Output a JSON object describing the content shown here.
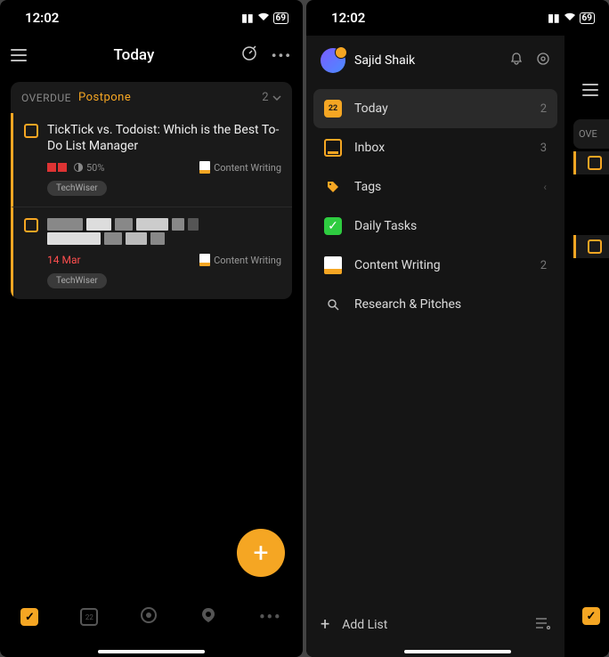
{
  "statusbar": {
    "time": "12:02",
    "battery": "69"
  },
  "left": {
    "title": "Today",
    "section": {
      "label": "OVERDUE",
      "postpone": "Postpone",
      "count": "2"
    },
    "tasks": [
      {
        "title": "TickTick vs. Todoist: Which is the Best To-Do List Manager",
        "progress": "50%",
        "label": "Content Writing",
        "tag": "TechWiser"
      },
      {
        "title_censored": true,
        "date": "14 Mar",
        "label": "Content Writing",
        "tag": "TechWiser"
      }
    ],
    "tabbar": {
      "calendar_day": "22"
    }
  },
  "right": {
    "profile_name": "Sajid Shaik",
    "menu": [
      {
        "icon": "today",
        "label": "Today",
        "count": "2",
        "active": true,
        "day": "22"
      },
      {
        "icon": "inbox",
        "label": "Inbox",
        "count": "3"
      },
      {
        "icon": "tags",
        "label": "Tags",
        "chevron": true
      },
      {
        "icon": "daily",
        "label": "Daily Tasks"
      },
      {
        "icon": "content",
        "label": "Content Writing",
        "count": "2"
      },
      {
        "icon": "research",
        "label": "Research & Pitches"
      }
    ],
    "add_list": "Add List",
    "behind_label": "OVE"
  }
}
